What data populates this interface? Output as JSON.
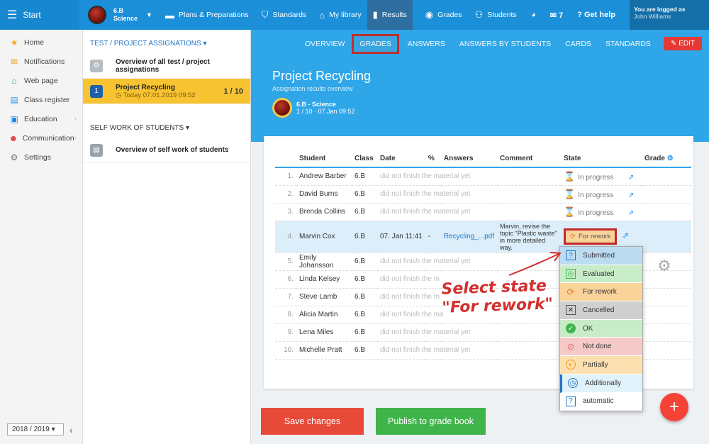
{
  "topbar": {
    "start": "Start",
    "class_name": "6.B",
    "class_subject": "Science",
    "items": [
      {
        "label": "Plans & Preparations",
        "icon": "calendar-icon"
      },
      {
        "label": "Standards",
        "icon": "shield-icon"
      },
      {
        "label": "My library",
        "icon": "library-icon"
      },
      {
        "label": "Results",
        "icon": "bar-chart-icon"
      },
      {
        "label": "Grades",
        "icon": "grades-icon"
      },
      {
        "label": "Students",
        "icon": "students-icon"
      }
    ],
    "mail_count": "7",
    "help": "Get help",
    "logged_as": "You are logged as",
    "user": "John Williams"
  },
  "leftnav": {
    "items": [
      "Home",
      "Notifications",
      "Web page",
      "Class register",
      "Education",
      "Communication",
      "Settings"
    ],
    "year": "2018 / 2019"
  },
  "assign": {
    "header": "TEST / PROJECT ASSIGNATIONS",
    "overview": "Overview of all test / project assignations",
    "selected_num": "1",
    "selected_title": "Project Recycling",
    "selected_date": "Today 07.01.2019 09:52",
    "selected_count": "1 / 10",
    "self_header": "SELF WORK OF STUDENTS",
    "self_item": "Overview of self work of students"
  },
  "main": {
    "tabs": [
      "OVERVIEW",
      "GRADES",
      "ANSWERS",
      "ANSWERS BY STUDENTS",
      "CARDS",
      "STANDARDS"
    ],
    "edit": "EDIT",
    "title": "Project Recycling",
    "subtitle": "Assignation results overview",
    "class_line": "6.B - Science",
    "class_sub": "1 / 10 · 07.Jan 09:52"
  },
  "table": {
    "headers": [
      "Student",
      "Class",
      "Date",
      "%",
      "Answers",
      "Comment",
      "State",
      "Grade"
    ],
    "rows": [
      {
        "n": "1.",
        "name": "Andrew Barber",
        "class": "6.B",
        "date": "did not finish the material yet",
        "state": "In progress"
      },
      {
        "n": "2.",
        "name": "David Burns",
        "class": "6.B",
        "date": "did not finish the material yet",
        "state": "In progress"
      },
      {
        "n": "3.",
        "name": "Brenda Collins",
        "class": "6.B",
        "date": "did not finish the material yet",
        "state": "In progress"
      },
      {
        "n": "4.",
        "name": "Marvin Cox",
        "class": "6.B",
        "date": "07. Jan 11:41",
        "pct": "-",
        "answers": "Recycling_...pdf",
        "comment": "Marvin, revise the topic \"Plastic waste\" in more detailed way.",
        "state": "For rework"
      },
      {
        "n": "5.",
        "name": "Emily Johansson",
        "class": "6.B",
        "date": "did not finish the material yet"
      },
      {
        "n": "6.",
        "name": "Linda Kelsey",
        "class": "6.B",
        "date": "did not finish the m"
      },
      {
        "n": "7.",
        "name": "Steve Lamb",
        "class": "6.B",
        "date": "did not finish the m"
      },
      {
        "n": "8.",
        "name": "Alicia Martin",
        "class": "6.B",
        "date": "did not finish the ma"
      },
      {
        "n": "9.",
        "name": "Lena Miles",
        "class": "6.B",
        "date": "did not finish the material yet"
      },
      {
        "n": "10.",
        "name": "Michelle Pratt",
        "class": "6.B",
        "date": "did not finish the material yet"
      }
    ]
  },
  "dropdown": {
    "options": [
      {
        "label": "Submitted",
        "color": "#bcdcf2"
      },
      {
        "label": "Evaluated",
        "color": "#c8ecc8"
      },
      {
        "label": "For rework",
        "color": "#f9d39a"
      },
      {
        "label": "Cancelled",
        "color": "#cfcfcf"
      },
      {
        "label": "OK",
        "color": "#c8ecc8"
      },
      {
        "label": "Not done",
        "color": "#f6c9c9"
      },
      {
        "label": "Partially",
        "color": "#fde0b0"
      },
      {
        "label": "Additionally",
        "color": "#e0f3fb"
      },
      {
        "label": "automatic",
        "color": "#ffffff"
      }
    ]
  },
  "annotation": {
    "line1": "Select state",
    "line2": "\"For rework\""
  },
  "buttons": {
    "save": "Save changes",
    "publish": "Publish to grade book",
    "fab": "+"
  }
}
